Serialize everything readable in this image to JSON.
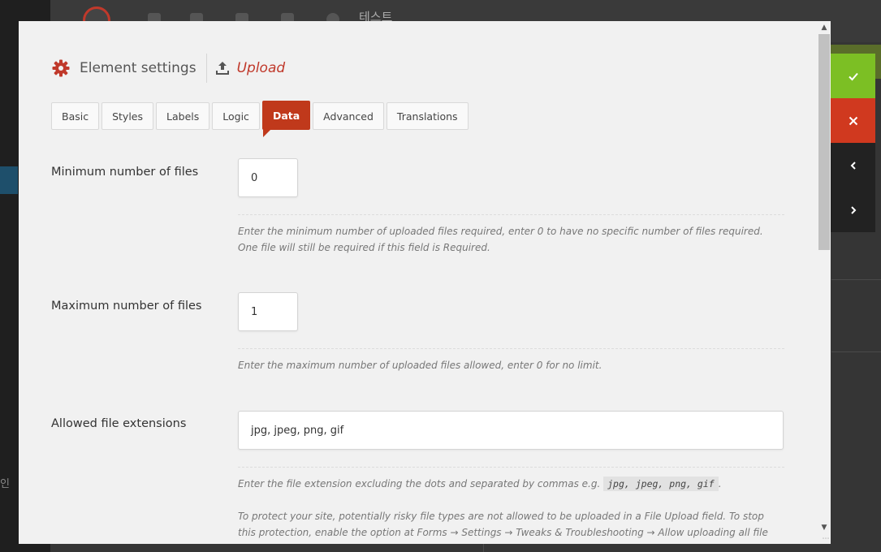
{
  "background": {
    "topbar_name": "테스트",
    "sidebar_fragment": "인"
  },
  "actions": {
    "ok_icon": "check-icon",
    "cancel_icon": "close-icon",
    "prev_icon": "chevron-left-icon",
    "next_icon": "chevron-right-icon"
  },
  "header": {
    "title": "Element settings",
    "element_name": "Upload"
  },
  "tabs": [
    {
      "label": "Basic"
    },
    {
      "label": "Styles"
    },
    {
      "label": "Labels"
    },
    {
      "label": "Logic"
    },
    {
      "label": "Data"
    },
    {
      "label": "Advanced"
    },
    {
      "label": "Translations"
    }
  ],
  "active_tab": "Data",
  "fields": {
    "min_files": {
      "label": "Minimum number of files",
      "value": "0",
      "help": "Enter the minimum number of uploaded files required, enter 0 to have no specific number of files required. One file will still be required if this field is Required."
    },
    "max_files": {
      "label": "Maximum number of files",
      "value": "1",
      "help": "Enter the maximum number of uploaded files allowed, enter 0 for no limit."
    },
    "extensions": {
      "label": "Allowed file extensions",
      "value": "jpg, jpeg, png, gif",
      "help_prefix": "Enter the file extension excluding the dots and separated by commas e.g.",
      "help_code": "jpg, jpeg, png, gif",
      "help_suffix": ".",
      "help2": "To protect your site, potentially risky file types are not allowed to be uploaded in a File Upload field. To stop this protection, enable the option at Forms → Settings → Tweaks & Troubleshooting → Allow uploading all file types."
    }
  },
  "colors": {
    "accent": "#c0392b",
    "ok": "#7cbf24",
    "cancel": "#d0391f"
  }
}
